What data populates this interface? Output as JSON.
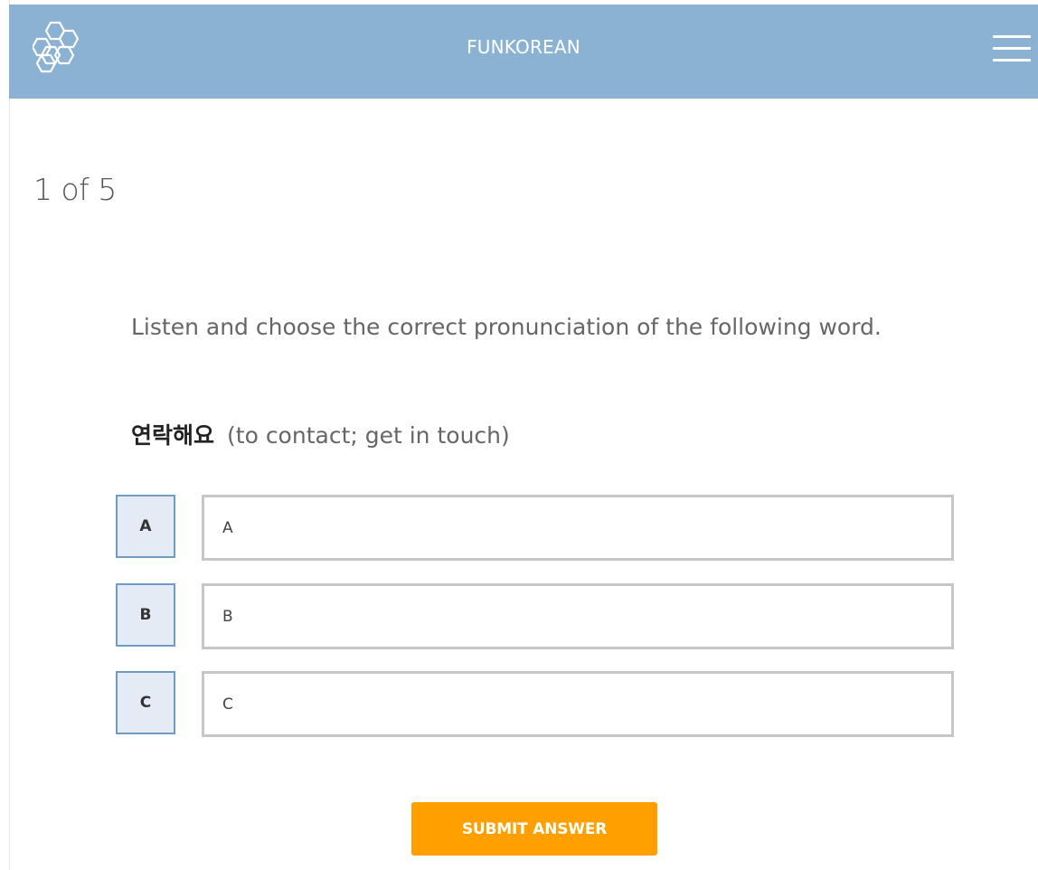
{
  "header": {
    "brand": "FUNKOREAN",
    "logo_icon": "hexagon-molecule-logo-icon",
    "menu_icon": "hamburger-menu-icon",
    "background_color": "#8bb2d3"
  },
  "quiz": {
    "progress": "1 of 5",
    "instruction": "Listen and choose the correct pronunciation of the following word.",
    "word": "연락해요",
    "meaning": "(to contact; get in touch)",
    "options": [
      {
        "letter": "A",
        "label": "A"
      },
      {
        "letter": "B",
        "label": "B"
      },
      {
        "letter": "C",
        "label": "C"
      }
    ],
    "submit_label": "SUBMIT ANSWER",
    "submit_color": "#ffa000"
  }
}
